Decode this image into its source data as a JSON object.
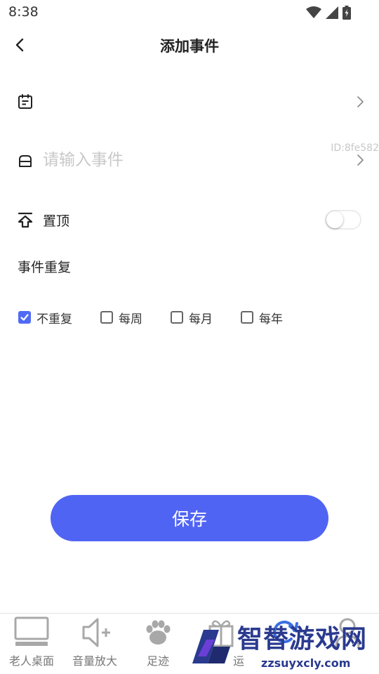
{
  "status_bar": {
    "time": "8:38"
  },
  "header": {
    "title": "添加事件"
  },
  "form": {
    "event_placeholder": "请输入事件",
    "event_value": "",
    "id_text": "ID:8fe582",
    "pin_label": "置顶",
    "pin_enabled": false,
    "repeat_label": "事件重复",
    "repeat_options": [
      {
        "label": "不重复",
        "checked": true
      },
      {
        "label": "每周",
        "checked": false
      },
      {
        "label": "每月",
        "checked": false
      },
      {
        "label": "每年",
        "checked": false
      }
    ]
  },
  "save_button": {
    "label": "保存"
  },
  "accent_color": "#5064f4",
  "bottom_nav": [
    {
      "label": "老人桌面",
      "icon": "monitor-icon"
    },
    {
      "label": "音量放大",
      "icon": "speaker-plus-icon"
    },
    {
      "label": "足迹",
      "icon": "paw-icon"
    },
    {
      "label": "运",
      "icon": "gift-icon"
    },
    {
      "label": "",
      "icon": "refresh-icon"
    },
    {
      "label": "",
      "icon": "person-icon"
    }
  ],
  "watermark": {
    "title": "智替游戏网",
    "url": "zzsuyxcly.com"
  }
}
